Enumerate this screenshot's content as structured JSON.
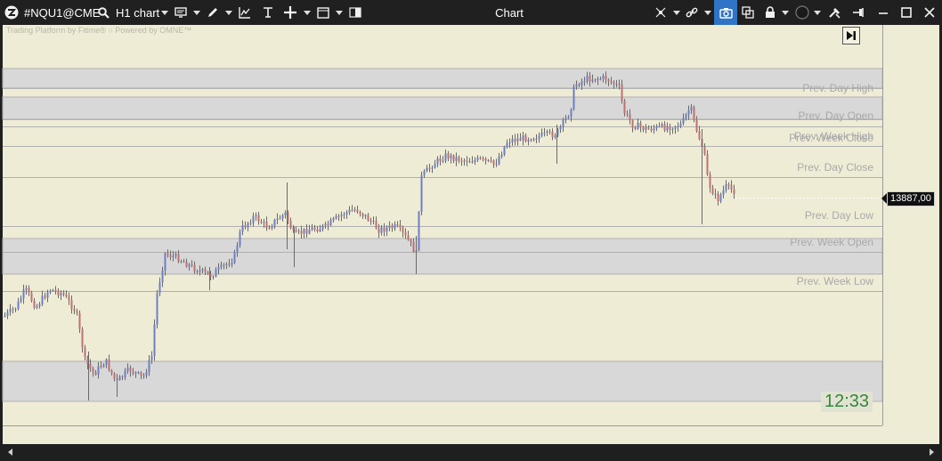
{
  "toolbar": {
    "symbol": "#NQU1@CME",
    "timeframe": "H1 chart",
    "window_title": "Chart"
  },
  "watermark": "Trading Platform by Fitime®  ○ Powered by OMNE™",
  "levels": [
    {
      "label": "Prev. Day High"
    },
    {
      "label": "Prev. Day Open"
    },
    {
      "label": "Prev. Week Close"
    },
    {
      "label": "Prev. Week High"
    },
    {
      "label": "Prev. Day Close"
    },
    {
      "label": "Prev. Day Low"
    },
    {
      "label": "Prev. Week Open"
    },
    {
      "label": "Prev. Week Low"
    }
  ],
  "price_tag": "13887,00",
  "clock": "12:33",
  "colors": {
    "chart_background": "#efecd6",
    "zone_fill": "#d8d8d8",
    "level_line": "#b0b0b0",
    "candle_up": "#6d7fc4",
    "candle_down": "#c07070",
    "clock_text": "#2f8a3a",
    "toolbar_active": "#2f74c6"
  },
  "icons": [
    "app-logo-icon",
    "search-icon",
    "template-icon",
    "pencil-icon",
    "indicators-icon",
    "draw-tool-icon",
    "crosshair-icon",
    "frame-icon",
    "layout-icon",
    "cursor-icon",
    "link-icon",
    "camera-icon",
    "duplicate-icon",
    "lock-icon",
    "color-circle-icon",
    "tools-icon",
    "pin-icon",
    "minimize-icon",
    "maximize-icon",
    "close-icon",
    "skip-to-end-icon"
  ]
}
